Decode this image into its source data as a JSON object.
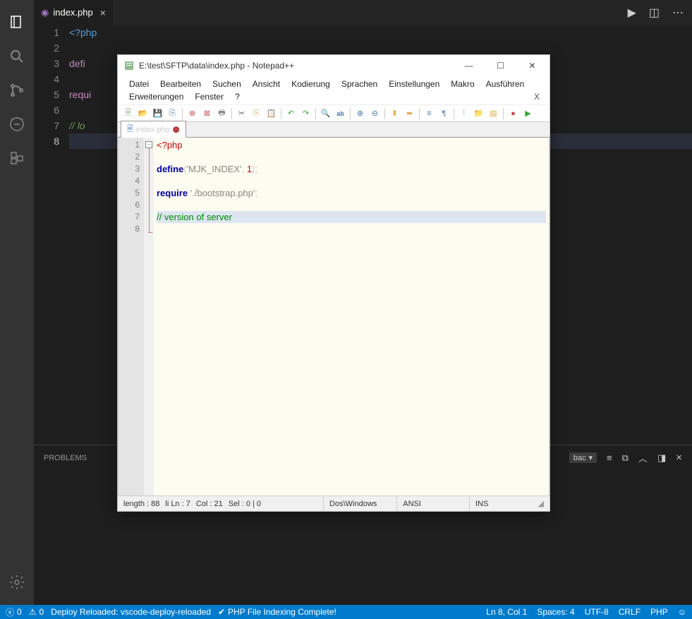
{
  "vscode": {
    "tab": {
      "label": "index.php",
      "iconName": "php-icon"
    },
    "editor": {
      "lines": [
        {
          "n": "1",
          "parts": [
            {
              "t": "<?php",
              "c": "tok-tag"
            }
          ]
        },
        {
          "n": "2",
          "parts": []
        },
        {
          "n": "3",
          "parts": [
            {
              "t": "defi",
              "c": "tok-kw"
            }
          ]
        },
        {
          "n": "4",
          "parts": []
        },
        {
          "n": "5",
          "parts": [
            {
              "t": "requi",
              "c": "tok-kw"
            }
          ]
        },
        {
          "n": "6",
          "parts": []
        },
        {
          "n": "7",
          "parts": [
            {
              "t": "// lo",
              "c": "tok-cmt"
            }
          ]
        },
        {
          "n": "8",
          "parts": [],
          "current": true
        }
      ]
    },
    "panel": {
      "tab": "PROBLEMS",
      "dropdown": "bac"
    },
    "status": {
      "errors": "0",
      "warnings": "0",
      "deploy": "Deploy Reloaded: vscode-deploy-reloaded",
      "indexing": "PHP File Indexing Complete!",
      "cursor": "Ln 8, Col 1",
      "spaces": "Spaces: 4",
      "encoding": "UTF-8",
      "eol": "CRLF",
      "lang": "PHP"
    }
  },
  "npp": {
    "title": "E:\\test\\SFTP\\data\\index.php - Notepad++",
    "menu": [
      "Datei",
      "Bearbeiten",
      "Suchen",
      "Ansicht",
      "Kodierung",
      "Sprachen",
      "Einstellungen",
      "Makro",
      "Ausführen",
      "Erweiterungen",
      "Fenster",
      "?"
    ],
    "tab": "index.php",
    "gutter": [
      "1",
      "2",
      "3",
      "4",
      "5",
      "6",
      "7",
      "8"
    ],
    "code": [
      [
        {
          "t": "<?php",
          "c": "np-tag"
        }
      ],
      [],
      [
        {
          "t": "define",
          "c": "np-kw"
        },
        {
          "t": "(",
          "c": ""
        },
        {
          "t": "'MJK_INDEX'",
          "c": "np-str"
        },
        {
          "t": ", ",
          "c": ""
        },
        {
          "t": "1",
          "c": "np-num"
        },
        {
          "t": ");",
          "c": ""
        }
      ],
      [],
      [
        {
          "t": "require ",
          "c": "np-kw"
        },
        {
          "t": "'./bootstrap.php'",
          "c": "np-str"
        },
        {
          "t": ";",
          "c": ""
        }
      ],
      [],
      [
        {
          "t": "// version of server",
          "c": "np-cmt",
          "hl": true
        }
      ],
      []
    ],
    "status": {
      "length": "length : 88",
      "lines": "li  Ln : 7",
      "col": "Col : 21",
      "sel": "Sel : 0 | 0",
      "eol": "Dos\\Windows",
      "enc": "ANSI",
      "mode": "INS"
    }
  }
}
